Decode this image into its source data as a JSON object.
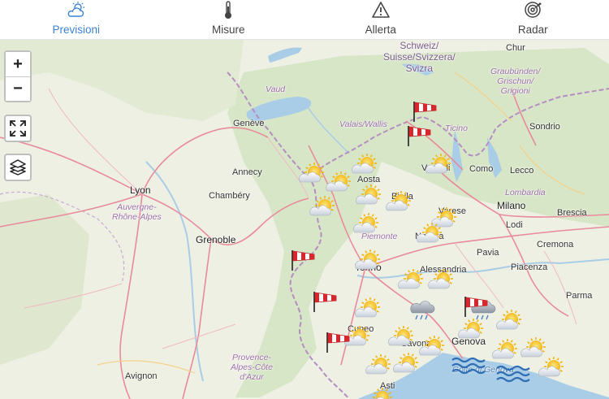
{
  "tabs": [
    {
      "label": "Previsioni",
      "icon": "partly-cloudy-icon",
      "active": true
    },
    {
      "label": "Misure",
      "icon": "thermometer-icon",
      "active": false
    },
    {
      "label": "Allerta",
      "icon": "warning-icon",
      "active": false
    },
    {
      "label": "Radar",
      "icon": "radar-icon",
      "active": false
    }
  ],
  "map_controls": {
    "zoom_in": "+",
    "zoom_out": "−"
  },
  "colors": {
    "accent": "#3b82d6",
    "sun": "#f6c21a",
    "windsock": "#d8262c",
    "sea": "#a9cde6"
  },
  "places": {
    "lyon": "Lyon",
    "grenoble": "Grenoble",
    "chambery": "Chambéry",
    "annecy": "Annecy",
    "geneve": "Genève",
    "avignon": "Avignon",
    "milano": "Milano",
    "torino": "Torino",
    "genova": "Genova",
    "como": "Como",
    "lecco": "Lecco",
    "sondrio": "Sondrio",
    "chur": "Chur",
    "brescia": "Brescia",
    "lodi": "Lodi",
    "cremona": "Cremona",
    "piacenza": "Piacenza",
    "parma": "Parma",
    "pavia": "Pavia",
    "alessandria": "Alessandria",
    "vercelli": "Vercelli",
    "savona": "Savona",
    "aosta": "Aosta",
    "biella": "Biella",
    "cuneo": "Cuneo",
    "varese": "Varese",
    "novara": "Novara",
    "asti": "Asti"
  },
  "regions": {
    "vaud": "Vaud",
    "valais": "Valais/Wallis",
    "ticino": "Ticino",
    "lombardia": "Lombardia",
    "piemonte": "Piemonte",
    "auvergne": "Auvergne-\nRhône-Alpes",
    "graubunden": "Graubünden/\nGrischun/\nGrigioni",
    "provence": "Provence-\nAlpes-Côte\nd'Azur",
    "golfo": "Golfo di Genova"
  },
  "country": "Schweiz/\nSuisse/Svizzera/\nSvizra"
}
